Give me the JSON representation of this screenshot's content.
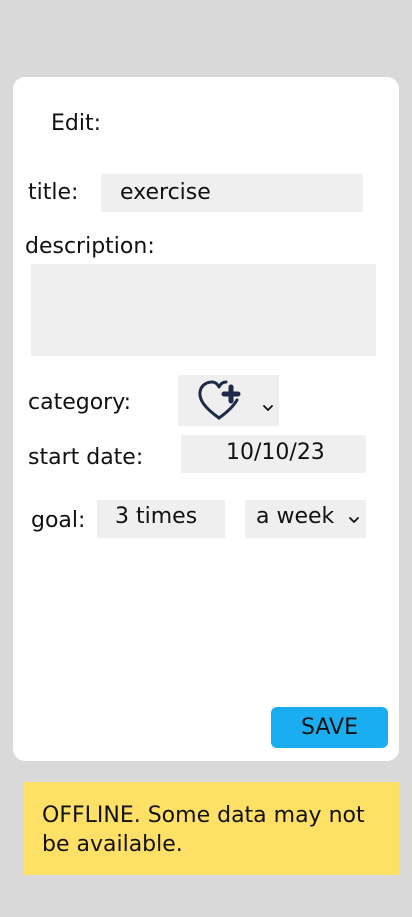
{
  "form": {
    "heading": "Edit:",
    "title_label": "title:",
    "title_value": "exercise",
    "description_label": "description:",
    "description_value": "",
    "category_label": "category:",
    "category_icon": "heart-plus-icon",
    "start_date_label": "start date:",
    "start_date_value": "10/10/23",
    "goal_label": "goal:",
    "goal_times_value": "3 times",
    "goal_frequency_value": "a week",
    "save_label": "SAVE"
  },
  "banner": {
    "text": "OFFLINE. Some data may not be available."
  },
  "colors": {
    "background": "#d9d9d9",
    "card": "#ffffff",
    "field": "#efefef",
    "save_button": "#1aaef0",
    "banner": "#ffe066",
    "icon_stroke": "#1e2a4a"
  }
}
